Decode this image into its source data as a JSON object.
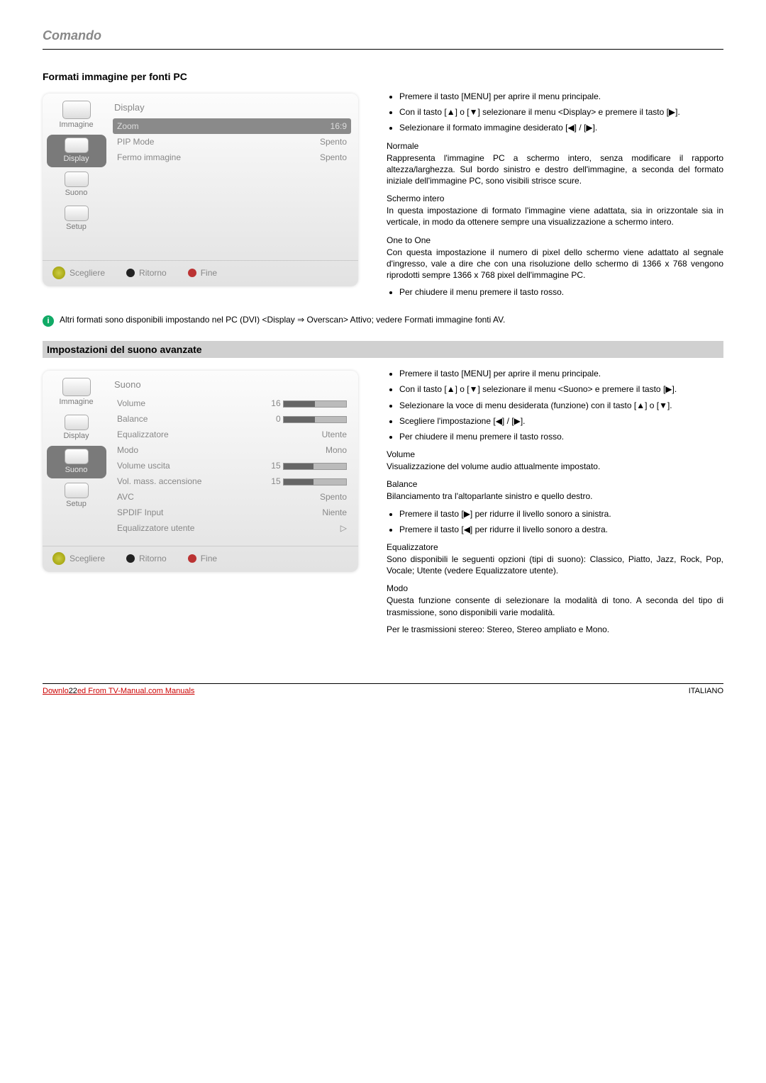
{
  "header": {
    "title": "Comando"
  },
  "section1": {
    "heading": "Formati immagine per fonti PC",
    "menu": {
      "title": "Display",
      "tabs": [
        "Immagine",
        "Display",
        "Suono",
        "Setup"
      ],
      "items": [
        {
          "label": "Zoom",
          "value": "16:9",
          "hl": true
        },
        {
          "label": "PIP Mode",
          "value": "Spento"
        },
        {
          "label": "Fermo immagine",
          "value": "Spento"
        }
      ],
      "footer": {
        "a": "Scegliere",
        "b": "Ritorno",
        "c": "Fine"
      }
    },
    "right": {
      "bullets1": [
        "Premere il tasto [MENU] per aprire il menu principale.",
        "Con il tasto [▲] o [▼] selezionare il menu <Display> e premere il tasto [▶].",
        "Selezionare il formato immagine desiderato [◀] / [▶]."
      ],
      "h1": "Normale",
      "p1": "Rappresenta l'immagine PC a schermo intero, senza modificare il rapporto altezza/larghezza. Sul bordo sinistro e destro dell'immagine, a seconda del formato iniziale dell'immagine PC, sono visibili strisce scure.",
      "h2": "Schermo intero",
      "p2": "In questa impostazione di formato l'immagine viene adattata, sia in orizzontale sia in verticale, in modo da ottenere sempre una visualizzazione a schermo intero.",
      "h3": "One to One",
      "p3": "Con questa impostazione il numero di pixel dello schermo viene adattato al segnale d'ingresso, vale a dire che con una risoluzione dello schermo di 1366 x 768 vengono riprodotti sempre 1366 x 768 pixel dell'immagine PC.",
      "bullets2": [
        "Per chiudere il menu premere il tasto rosso."
      ]
    },
    "note": "Altri formati sono disponibili impostando nel PC (DVI) <Display ⇒ Overscan> Attivo; vedere Formati immagine fonti AV."
  },
  "section2": {
    "heading": "Impostazioni del suono avanzate",
    "menu": {
      "title": "Suono",
      "tabs": [
        "Immagine",
        "Display",
        "Suono",
        "Setup"
      ],
      "items": [
        {
          "label": "Volume",
          "value": "16",
          "bar": 50
        },
        {
          "label": "Balance",
          "value": "0",
          "bar": 50
        },
        {
          "label": "Equalizzatore",
          "value": "Utente"
        },
        {
          "label": "Modo",
          "value": "Mono"
        },
        {
          "label": "Volume uscita",
          "value": "15",
          "bar": 48
        },
        {
          "label": "Vol. mass. accensione",
          "value": "15",
          "bar": 48
        },
        {
          "label": "AVC",
          "value": "Spento"
        },
        {
          "label": "SPDIF Input",
          "value": "Niente"
        },
        {
          "label": "Equalizzatore utente",
          "value": "▷"
        }
      ],
      "footer": {
        "a": "Scegliere",
        "b": "Ritorno",
        "c": "Fine"
      }
    },
    "right": {
      "bullets1": [
        "Premere il tasto [MENU] per aprire il menu principale.",
        "Con il tasto [▲] o [▼] selezionare il menu <Suono> e premere il tasto [▶].",
        "Selezionare la voce di menu desiderata (funzione) con il tasto [▲] o [▼].",
        "Scegliere l'impostazione [◀] / [▶].",
        "Per chiudere il menu premere il tasto rosso."
      ],
      "h1": "Volume",
      "p1": "Visualizzazione del volume audio attualmente impostato.",
      "h2": "Balance",
      "p2": "Bilanciamento tra l'altoparlante sinistro e quello destro.",
      "bullets2": [
        "Premere il tasto [▶] per ridurre il livello sonoro a sinistra.",
        "Premere il tasto [◀] per ridurre il livello sonoro a destra."
      ],
      "h3": "Equalizzatore",
      "p3": "Sono disponibili le seguenti opzioni (tipi di suono): Classico, Piatto, Jazz, Rock, Pop, Vocale; Utente (vedere Equalizzatore utente).",
      "h4": "Modo",
      "p4": "Questa funzione consente di selezionare la modalità di tono. A seconda del tipo di trasmissione, sono disponibili varie modalità.",
      "p5": "Per le trasmissioni stereo: Stereo, Stereo ampliato e Mono."
    }
  },
  "footer": {
    "left_pre": "Downlo",
    "left_mid": "22",
    "left_link": "ed From TV-Manual.com Manuals",
    "right": "ITALIANO"
  }
}
